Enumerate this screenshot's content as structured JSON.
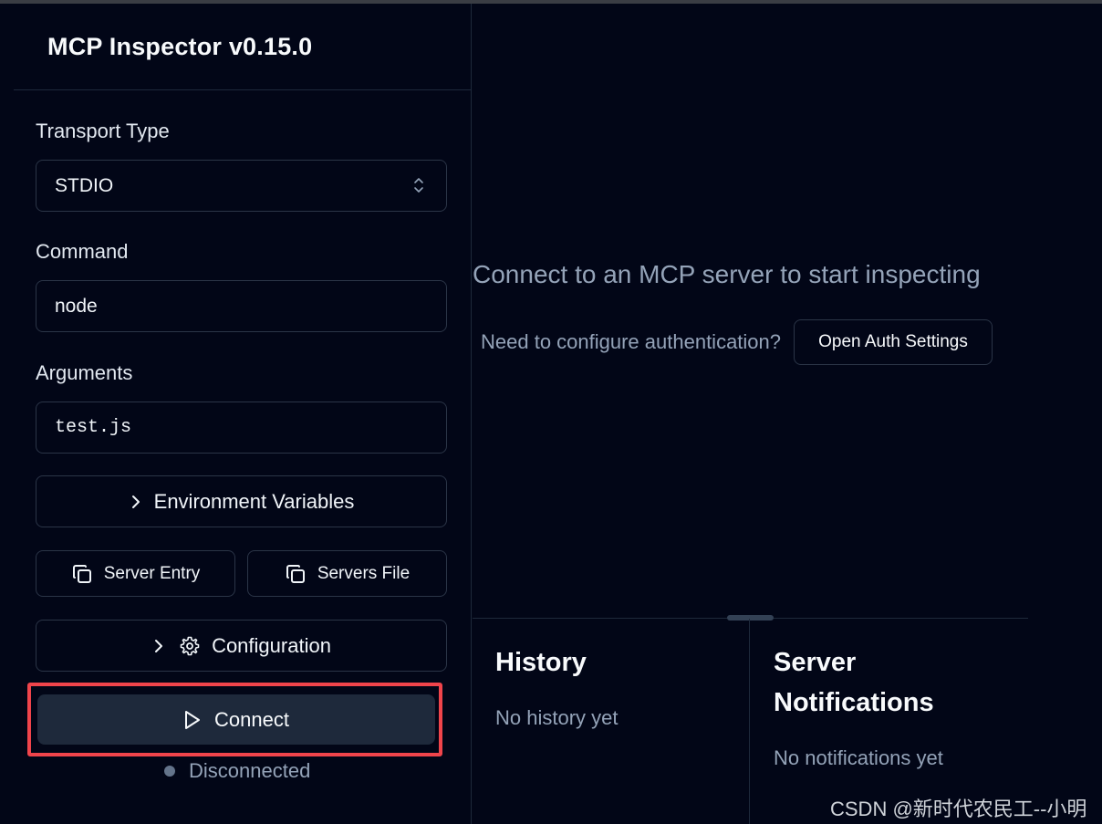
{
  "sidebar": {
    "title": "MCP Inspector v0.15.0",
    "transport": {
      "label": "Transport Type",
      "value": "STDIO"
    },
    "command": {
      "label": "Command",
      "value": "node"
    },
    "arguments": {
      "label": "Arguments",
      "value": "test.js"
    },
    "env_button": "Environment Variables",
    "server_entry_button": "Server Entry",
    "servers_file_button": "Servers File",
    "config_button": "Configuration",
    "connect_button": "Connect",
    "status": "Disconnected"
  },
  "main": {
    "message": "Connect to an MCP server to start inspecting",
    "auth_question": "Need to configure authentication?",
    "auth_button": "Open Auth Settings"
  },
  "history": {
    "title": "History",
    "empty": "No history yet"
  },
  "notifications": {
    "title_line1": "Server",
    "title_line2": "Notifications",
    "empty": "No notifications yet"
  },
  "watermark": "CSDN @新时代农民工--小明",
  "colors": {
    "background": "#020617",
    "border": "#2b3547",
    "muted_text": "#94a3b8",
    "highlight": "#f0444b"
  }
}
